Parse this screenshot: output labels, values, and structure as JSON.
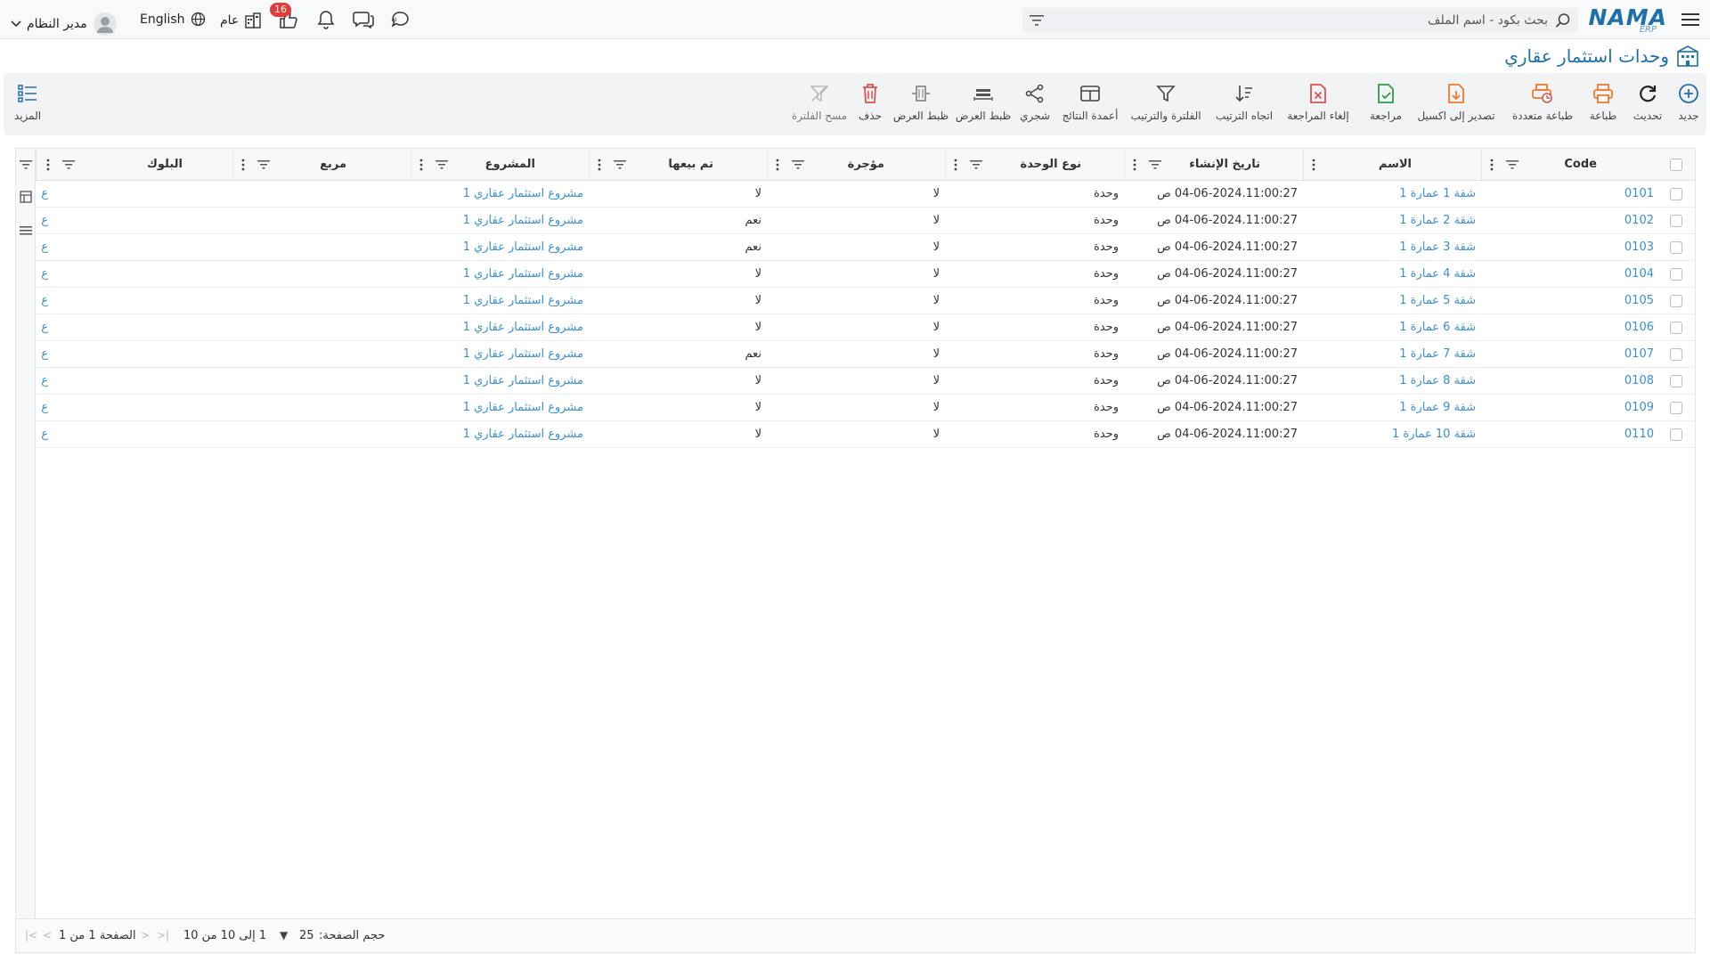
{
  "topbar": {
    "logo_text": "NAMA",
    "logo_sub": "ERP",
    "search_placeholder": "بحث بكود - اسم الملف",
    "badge_count": "16",
    "company": "عام",
    "language": "English",
    "user_name": "مدير النظام"
  },
  "page": {
    "title": "وحدات استثمار عقاري"
  },
  "toolbar": {
    "new": "جديد",
    "refresh": "تحديث",
    "print": "طباعة",
    "multi_print": "طباعة متعددة",
    "export_excel": "تصدير إلى اكسيل",
    "review": "مراجعة",
    "cancel_review": "إلغاء المراجعة",
    "sort_direction": "اتجاه الترتيب",
    "filter_sort": "الفلترة والترتيب",
    "result_columns": "أعمدة النتائج",
    "tree": "شجري",
    "fit_width_1": "ظبط العرض",
    "fit_width_2": "ظبط العرض",
    "delete": "حذف",
    "clear_filter": "مسح الفلترة",
    "more": "المزيد"
  },
  "grid": {
    "columns": {
      "code": "Code",
      "name": "الاسم",
      "created": "تاريخ الإنشاء",
      "unit_type": "نوع الوحدة",
      "rented": "مؤجرة",
      "sold": "تم بيعها",
      "project": "المشروع",
      "square": "مربع",
      "block": "البلوك"
    },
    "rows": [
      {
        "code": "0101",
        "name": "شقة 1 عمارة 1",
        "created": "04-06-2024.11:00:27 ص",
        "unit_type": "وحدة",
        "rented": "لا",
        "sold": "لا",
        "project": "مشروع استثمار عقاري 1",
        "extra": "ع"
      },
      {
        "code": "0102",
        "name": "شقة 2 عمارة 1",
        "created": "04-06-2024.11:00:27 ص",
        "unit_type": "وحدة",
        "rented": "لا",
        "sold": "نعم",
        "project": "مشروع استثمار عقاري 1",
        "extra": "ع"
      },
      {
        "code": "0103",
        "name": "شقة 3 عمارة 1",
        "created": "04-06-2024.11:00:27 ص",
        "unit_type": "وحدة",
        "rented": "لا",
        "sold": "نعم",
        "project": "مشروع استثمار عقاري 1",
        "extra": "ع"
      },
      {
        "code": "0104",
        "name": "شقة 4 عمارة 1",
        "created": "04-06-2024.11:00:27 ص",
        "unit_type": "وحدة",
        "rented": "لا",
        "sold": "لا",
        "project": "مشروع استثمار عقاري 1",
        "extra": "ع"
      },
      {
        "code": "0105",
        "name": "شقة 5 عمارة 1",
        "created": "04-06-2024.11:00:27 ص",
        "unit_type": "وحدة",
        "rented": "لا",
        "sold": "لا",
        "project": "مشروع استثمار عقاري 1",
        "extra": "ع"
      },
      {
        "code": "0106",
        "name": "شقة 6 عمارة 1",
        "created": "04-06-2024.11:00:27 ص",
        "unit_type": "وحدة",
        "rented": "لا",
        "sold": "لا",
        "project": "مشروع استثمار عقاري 1",
        "extra": "ع"
      },
      {
        "code": "0107",
        "name": "شقة 7 عمارة 1",
        "created": "04-06-2024.11:00:27 ص",
        "unit_type": "وحدة",
        "rented": "لا",
        "sold": "نعم",
        "project": "مشروع استثمار عقاري 1",
        "extra": "ع"
      },
      {
        "code": "0108",
        "name": "شقة 8 عمارة 1",
        "created": "04-06-2024.11:00:27 ص",
        "unit_type": "وحدة",
        "rented": "لا",
        "sold": "لا",
        "project": "مشروع استثمار عقاري 1",
        "extra": "ع"
      },
      {
        "code": "0109",
        "name": "شقة 9 عمارة 1",
        "created": "04-06-2024.11:00:27 ص",
        "unit_type": "وحدة",
        "rented": "لا",
        "sold": "لا",
        "project": "مشروع استثمار عقاري 1",
        "extra": "ع"
      },
      {
        "code": "0110",
        "name": "شقة 10 عمارة 1",
        "created": "04-06-2024.11:00:27 ص",
        "unit_type": "وحدة",
        "rented": "لا",
        "sold": "لا",
        "project": "مشروع استثمار عقاري 1",
        "extra": "ع"
      }
    ]
  },
  "footer": {
    "page_size_label": "حجم الصفحة:",
    "page_size": "25",
    "range": "1 إلى 10 من 10",
    "page_info": "الصفحة 1 من 1"
  },
  "colors": {
    "brand": "#1f6fa8",
    "link": "#3b8fcf",
    "badge": "#e23b3b",
    "print": "#f07b2c",
    "delete": "#d9534f"
  },
  "icons": [
    "menu-icon",
    "search-icon",
    "filter-icon",
    "plus-circle-icon",
    "refresh-icon",
    "printer-icon",
    "excel-icon",
    "trash-icon",
    "tree-icon",
    "columns-icon",
    "user-icon",
    "globe-icon",
    "bell-icon",
    "chat-icon"
  ]
}
